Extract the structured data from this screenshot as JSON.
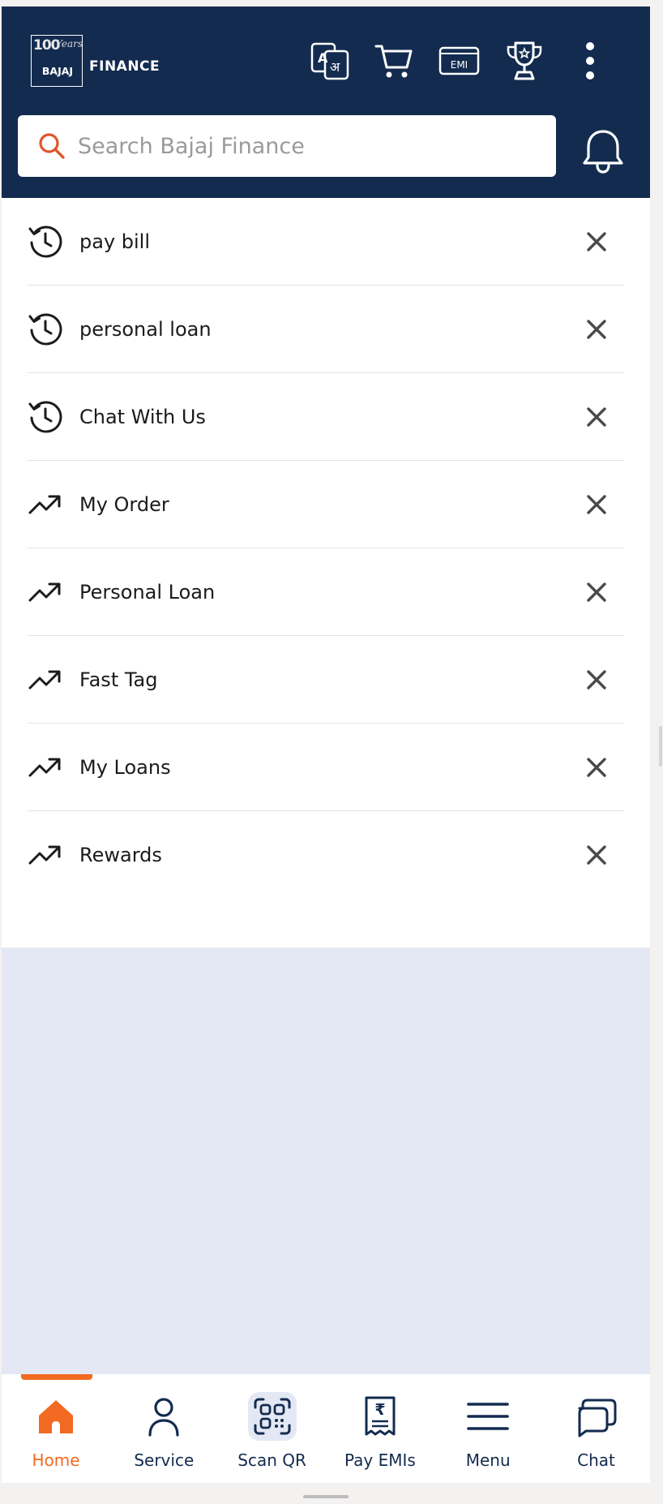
{
  "header": {
    "logo": {
      "years_label": "100",
      "years_suffix": "Years",
      "brand": "BAJAJ",
      "wordmark": "FINANCE"
    },
    "icons": [
      "translate-icon",
      "cart-icon",
      "emi-card-icon",
      "trophy-icon",
      "more-vertical-icon"
    ],
    "emi_icon_text": "EMI",
    "translate_icon_text_a": "A",
    "translate_icon_text_b": "अ"
  },
  "search": {
    "placeholder": "Search Bajaj Finance",
    "value": ""
  },
  "suggestions": [
    {
      "type": "recent",
      "icon": "history-icon",
      "label": "pay bill"
    },
    {
      "type": "recent",
      "icon": "history-icon",
      "label": "personal loan"
    },
    {
      "type": "recent",
      "icon": "history-icon",
      "label": "Chat With Us"
    },
    {
      "type": "trending",
      "icon": "trending-up-icon",
      "label": "My Order"
    },
    {
      "type": "trending",
      "icon": "trending-up-icon",
      "label": "Personal Loan"
    },
    {
      "type": "trending",
      "icon": "trending-up-icon",
      "label": "Fast Tag"
    },
    {
      "type": "trending",
      "icon": "trending-up-icon",
      "label": "My Loans"
    },
    {
      "type": "trending",
      "icon": "trending-up-icon",
      "label": "Rewards"
    }
  ],
  "bottom_nav": [
    {
      "label": "Home",
      "icon": "home-icon",
      "active": true
    },
    {
      "label": "Service",
      "icon": "user-icon",
      "active": false
    },
    {
      "label": "Scan QR",
      "icon": "qr-scan-icon",
      "active": false
    },
    {
      "label": "Pay EMIs",
      "icon": "rupee-bill-icon",
      "active": false
    },
    {
      "label": "Menu",
      "icon": "menu-icon",
      "active": false
    },
    {
      "label": "Chat",
      "icon": "chat-icon",
      "active": false
    }
  ],
  "colors": {
    "header_bg": "#132b4f",
    "accent": "#f26a21",
    "page_bg": "#e4e8f4"
  }
}
